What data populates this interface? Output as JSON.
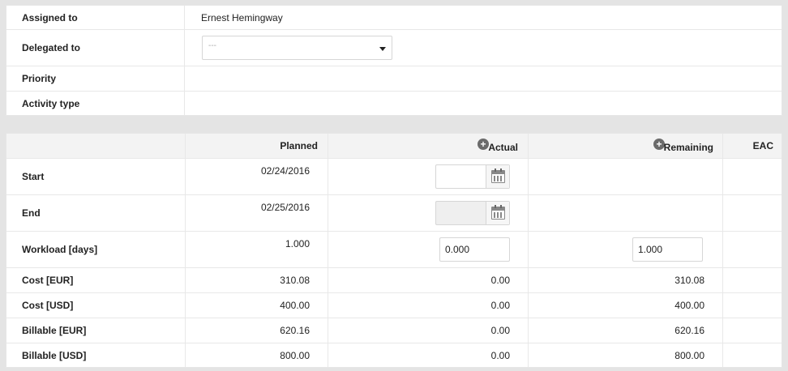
{
  "info": {
    "assigned_to": {
      "label": "Assigned to",
      "value": "Ernest Hemingway"
    },
    "delegated_to": {
      "label": "Delegated to",
      "placeholder": "---"
    },
    "priority": {
      "label": "Priority",
      "value": ""
    },
    "activity_type": {
      "label": "Activity type",
      "value": ""
    }
  },
  "grid": {
    "columns": {
      "planned": "Planned",
      "actual": "Actual",
      "remaining": "Remaining",
      "eac": "EAC"
    },
    "rows": {
      "start": {
        "label": "Start",
        "planned": "02/24/2016",
        "actual": ""
      },
      "end": {
        "label": "End",
        "planned": "02/25/2016",
        "actual": ""
      },
      "workload": {
        "label": "Workload [days]",
        "planned": "1.000",
        "actual": "0.000",
        "remaining": "1.000"
      },
      "cost_eur": {
        "label": "Cost [EUR]",
        "planned": "310.08",
        "actual": "0.00",
        "remaining": "310.08"
      },
      "cost_usd": {
        "label": "Cost [USD]",
        "planned": "400.00",
        "actual": "0.00",
        "remaining": "400.00"
      },
      "billable_eur": {
        "label": "Billable [EUR]",
        "planned": "620.16",
        "actual": "0.00",
        "remaining": "620.16"
      },
      "billable_usd": {
        "label": "Billable [USD]",
        "planned": "800.00",
        "actual": "0.00",
        "remaining": "800.00"
      }
    }
  },
  "icons": {
    "add": "plus-circle-icon",
    "calendar": "calendar-icon",
    "dropdown": "chevron-down-icon"
  },
  "colors": {
    "background": "#e4e4e4",
    "header_bg": "#f3f3f3",
    "icon_gray": "#6b6b6b"
  }
}
